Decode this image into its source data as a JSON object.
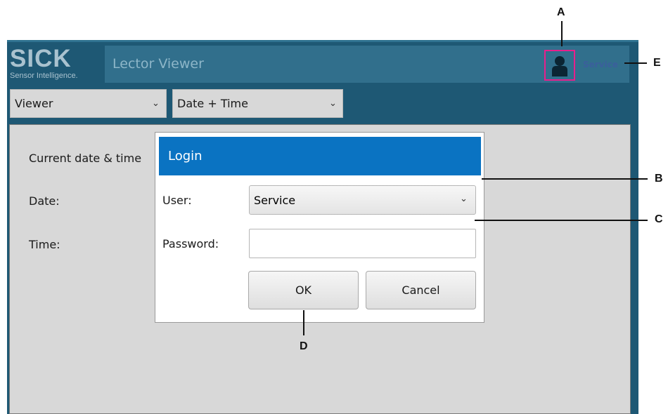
{
  "logo": {
    "main": "SICK",
    "tagline": "Sensor Intelligence."
  },
  "header": {
    "app_title": "Lector Viewer",
    "user_icon": "user-icon",
    "user_label": "Service"
  },
  "toolbar": {
    "view_select": "Viewer",
    "page_select": "Date + Time"
  },
  "content": {
    "current_label": "Current date & time",
    "date_label": "Date:",
    "time_label": "Time:"
  },
  "login_dialog": {
    "title": "Login",
    "user_label": "User:",
    "user_value": "Service",
    "password_label": "Password:",
    "password_value": "",
    "ok_label": "OK",
    "cancel_label": "Cancel"
  },
  "callouts": {
    "a": "A",
    "b": "B",
    "c": "C",
    "d": "D",
    "e": "E"
  },
  "colors": {
    "app_background": "#1e5874",
    "titlebar": "#316f8c",
    "dialog_header": "#0a73c2",
    "highlight_box": "#e91e8c",
    "content_panel": "#d8d8d8"
  }
}
